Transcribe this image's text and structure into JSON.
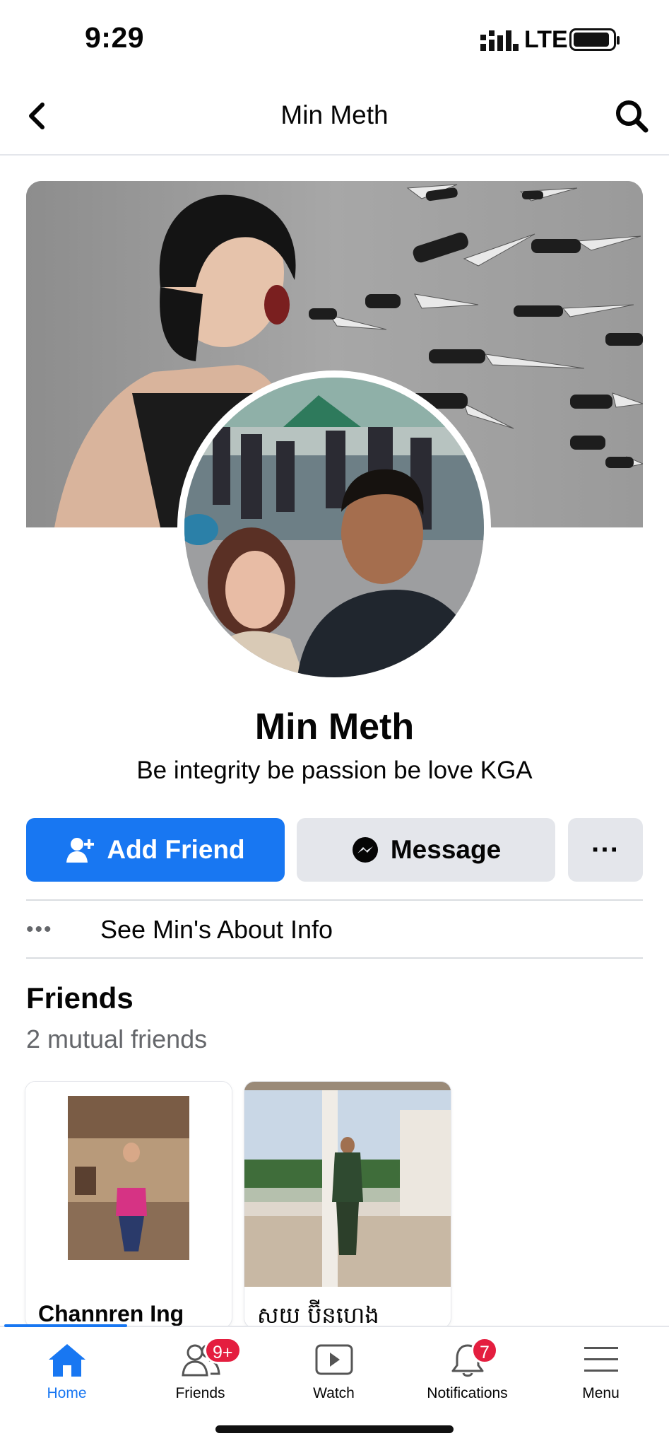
{
  "status_bar": {
    "time": "9:29",
    "network": "LTE"
  },
  "header": {
    "title": "Min Meth"
  },
  "profile": {
    "name": "Min Meth",
    "bio": "Be integrity be passion be love KGA"
  },
  "actions": {
    "add_friend": "Add Friend",
    "message": "Message",
    "more": "···"
  },
  "about": {
    "dots": "•••",
    "label": "See Min's About Info"
  },
  "friends": {
    "title": "Friends",
    "subtitle": "2 mutual friends",
    "items": [
      {
        "name": "Channren Ing"
      },
      {
        "name": "សយ ប៊ីនហេង"
      }
    ]
  },
  "tab_bar": {
    "tabs": [
      {
        "label": "Home",
        "icon": "home-icon",
        "active": true
      },
      {
        "label": "Friends",
        "icon": "friends-icon",
        "badge": "9+"
      },
      {
        "label": "Watch",
        "icon": "watch-icon"
      },
      {
        "label": "Notifications",
        "icon": "bell-icon",
        "badge": "7"
      },
      {
        "label": "Menu",
        "icon": "menu-icon"
      }
    ]
  },
  "colors": {
    "accent": "#1877f2",
    "badge": "#e41e3f",
    "secondary_button": "#e4e6eb",
    "secondary_text": "#65676b"
  }
}
